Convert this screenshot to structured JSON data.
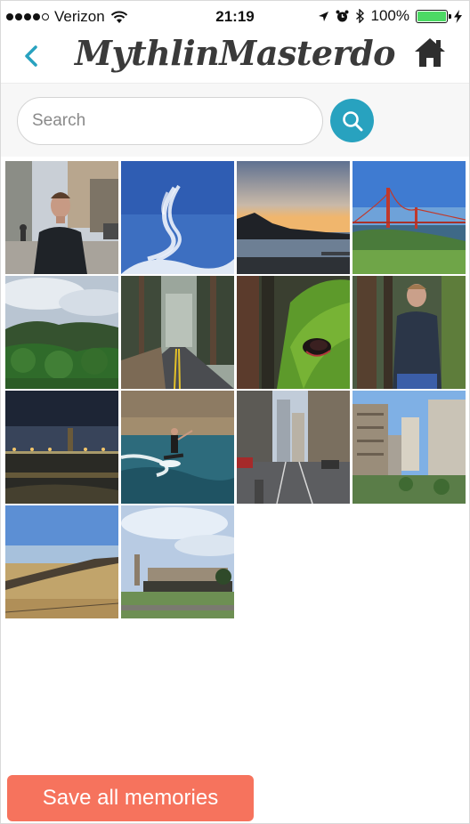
{
  "status_bar": {
    "carrier": "Verizon",
    "time": "21:19",
    "battery": "100%",
    "icons": [
      "signal-dots-icon",
      "wifi-icon",
      "location-arrow-icon",
      "alarm-clock-icon",
      "bluetooth-icon",
      "battery-icon",
      "charging-bolt-icon"
    ]
  },
  "nav": {
    "title": "MythlinMasterdo",
    "back_icon": "chevron-left-icon",
    "home_icon": "home-icon"
  },
  "search": {
    "placeholder": "Search",
    "value": "",
    "button_icon": "magnifier-icon"
  },
  "photos": [
    {
      "subject": "man on city street"
    },
    {
      "subject": "jet contrails in blue sky"
    },
    {
      "subject": "sunset over water"
    },
    {
      "subject": "golden gate bridge"
    },
    {
      "subject": "green hills and clouds"
    },
    {
      "subject": "foggy forest road"
    },
    {
      "subject": "mossy tree trunk"
    },
    {
      "subject": "man sitting in forest"
    },
    {
      "subject": "pier at night"
    },
    {
      "subject": "wakeboarder on lake"
    },
    {
      "subject": "downtown street view"
    },
    {
      "subject": "city buildings from above"
    },
    {
      "subject": "dry grassland"
    },
    {
      "subject": "ferry building"
    }
  ],
  "footer": {
    "save_label": "Save all memories"
  },
  "colors": {
    "accent": "#28a2bf",
    "save_button": "#f6735d",
    "battery_fill": "#4cd964"
  }
}
